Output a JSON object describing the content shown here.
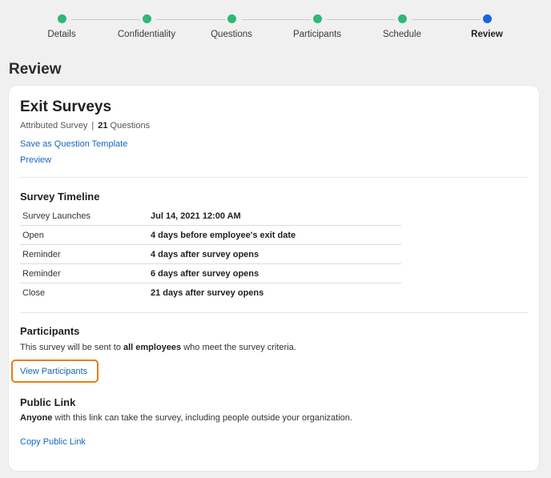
{
  "stepper": {
    "steps": [
      {
        "label": "Details",
        "state": "complete"
      },
      {
        "label": "Confidentiality",
        "state": "complete"
      },
      {
        "label": "Questions",
        "state": "complete"
      },
      {
        "label": "Participants",
        "state": "complete"
      },
      {
        "label": "Schedule",
        "state": "complete"
      },
      {
        "label": "Review",
        "state": "current"
      }
    ]
  },
  "page": {
    "title": "Review"
  },
  "survey": {
    "title": "Exit Surveys",
    "type": "Attributed Survey",
    "separator": "|",
    "question_count": "21",
    "question_word": "Questions",
    "save_template_link": "Save as Question Template",
    "preview_link": "Preview"
  },
  "timeline": {
    "title": "Survey Timeline",
    "rows": [
      {
        "label": "Survey Launches",
        "value": "Jul 14, 2021 12:00 AM"
      },
      {
        "label": "Open",
        "value": "4 days before employee's exit date"
      },
      {
        "label": "Reminder",
        "value": "4 days after survey opens"
      },
      {
        "label": "Reminder",
        "value": "6 days after survey opens"
      },
      {
        "label": "Close",
        "value": "21 days after survey opens"
      }
    ]
  },
  "participants": {
    "title": "Participants",
    "text_before": "This survey will be sent to ",
    "text_bold": "all employees",
    "text_after": " who meet the survey criteria.",
    "view_link": "View Participants"
  },
  "public_link": {
    "title": "Public Link",
    "text_bold": "Anyone",
    "text_after": " with this link can take the survey, including people outside your organization.",
    "copy_link": "Copy Public Link"
  },
  "colors": {
    "complete": "#2eb872",
    "current": "#1565e0",
    "link": "#1565c0",
    "highlight": "#e97d10"
  }
}
